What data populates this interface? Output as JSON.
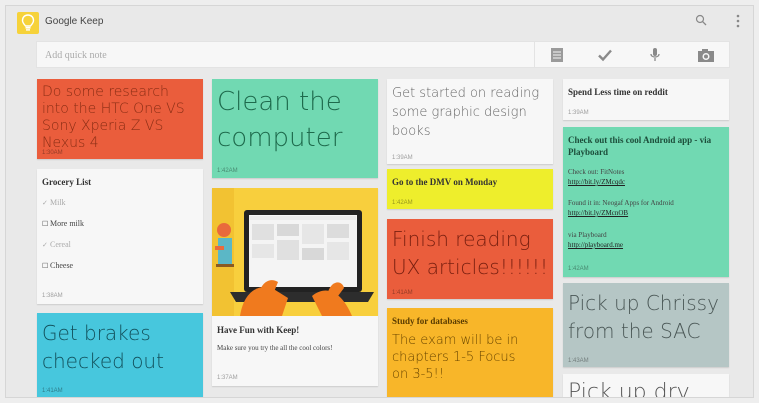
{
  "app": {
    "title": "Google Keep",
    "accent": "#f6d23a"
  },
  "toolbar": {
    "search_icon": "search-icon",
    "menu_icon": "more-vert-icon"
  },
  "quick_note": {
    "placeholder": "Add quick note",
    "icons": [
      "list-icon",
      "check-icon",
      "microphone-icon",
      "camera-icon"
    ]
  },
  "notes": {
    "htc": {
      "text": "Do some research into the HTC One VS Sony Xperia Z VS Nexus 4",
      "time": "1:30AM",
      "color": "#ea5d3c"
    },
    "grocery": {
      "title": "Grocery List",
      "items": [
        {
          "label": "Milk",
          "checked": true
        },
        {
          "label": "More milk",
          "checked": false
        },
        {
          "label": "Cereal",
          "checked": true
        },
        {
          "label": "Cheese",
          "checked": false
        }
      ],
      "time": "1:38AM",
      "color": "#f7f7f7"
    },
    "brakes": {
      "text": "Get brakes checked out",
      "time": "1:41AM",
      "color": "#47c7dd"
    },
    "clean": {
      "text": "Clean the computer",
      "time": "1:42AM",
      "color": "#71d9b2"
    },
    "fun": {
      "title": "Have Fun with Keep!",
      "body": "Make sure you try the all the cool colors!",
      "time": "1:37AM",
      "color": "#f7f7f7"
    },
    "graphic": {
      "text": "Get started on reading some graphic design books",
      "time": "1:39AM",
      "color": "#f7f7f7"
    },
    "dmv": {
      "title": "Go to the DMV on Monday",
      "time": "1:42AM",
      "color": "#eeee2c"
    },
    "ux": {
      "text": "Finish reading UX articles!!!!!!",
      "time": "1:41AM",
      "color": "#ea5d3c"
    },
    "study": {
      "title": "Study for databases",
      "body": "The exam will be in chapters 1-5 Focus on 3-5!!",
      "color": "#f8b629"
    },
    "reddit": {
      "title": "Spend Less time on reddit",
      "time": "1:39AM",
      "color": "#f7f7f7"
    },
    "android": {
      "title": "Check out this cool Android app - via Playboard",
      "line1": "Check out: FitNotes",
      "link1": "http://bit.ly/ZMcqdc",
      "line2": "Found it in: Neogaf Apps for Android",
      "link2": "http://bit.ly/ZMcnOB",
      "line3": "via Playboard",
      "link3": "http://playboard.me",
      "time": "1:42AM",
      "color": "#71d9b2"
    },
    "chrissy": {
      "text": "Pick up Chrissy from the SAC",
      "time": "1:43AM",
      "color": "#b5c6c5"
    },
    "drycleaning": {
      "text": "Pick up dry",
      "color": "#f7f7f7"
    }
  }
}
